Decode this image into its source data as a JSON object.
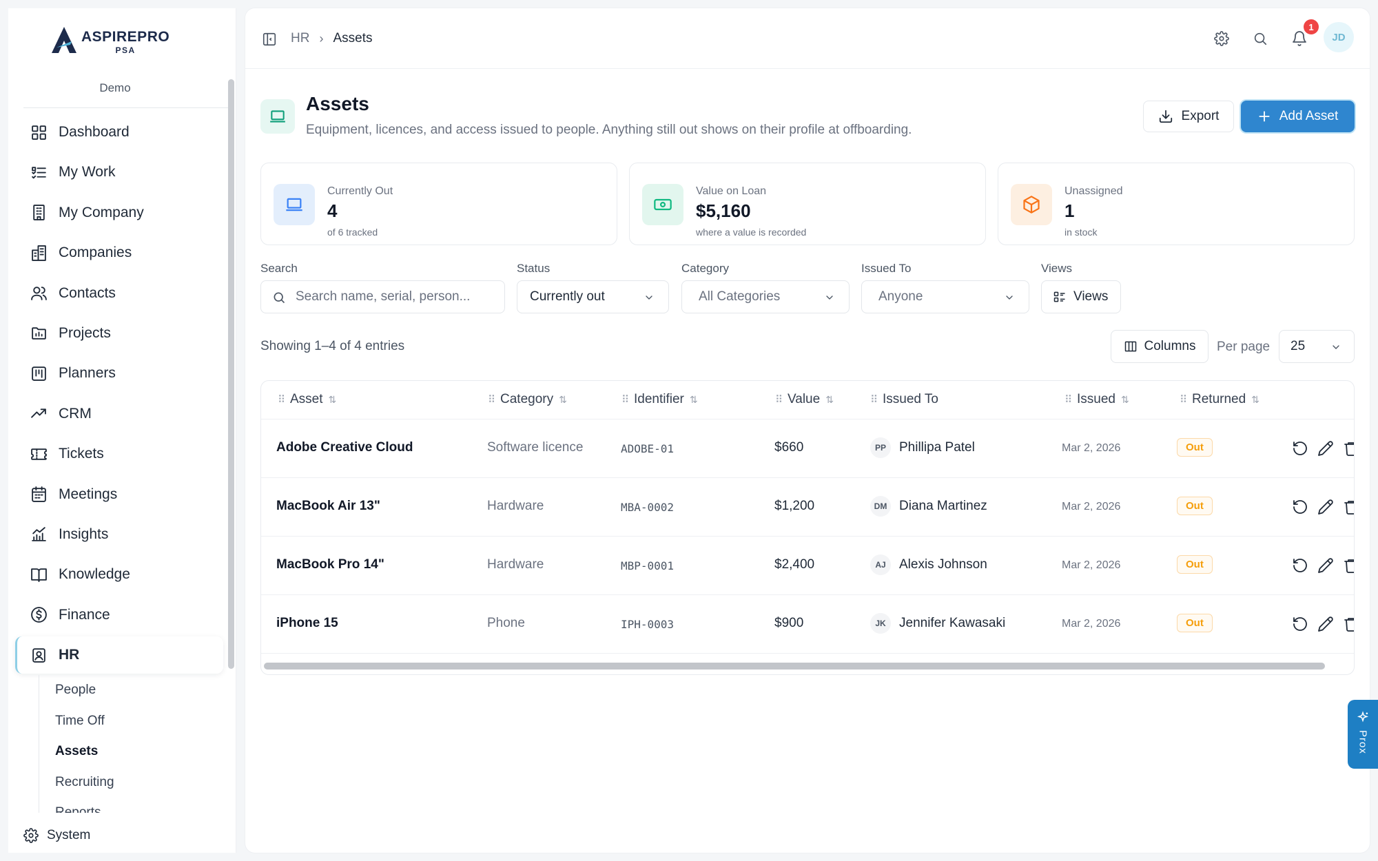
{
  "brand": {
    "name": "ASPIREPRO",
    "sub": "PSA",
    "workspace": "Demo"
  },
  "sidebar": {
    "items": [
      {
        "label": "Dashboard",
        "icon": "dashboard-icon"
      },
      {
        "label": "My Work",
        "icon": "checklist-icon"
      },
      {
        "label": "My Company",
        "icon": "building-icon"
      },
      {
        "label": "Companies",
        "icon": "office-buildings-icon"
      },
      {
        "label": "Contacts",
        "icon": "users-icon"
      },
      {
        "label": "Projects",
        "icon": "folder-chart-icon"
      },
      {
        "label": "Planners",
        "icon": "board-icon"
      },
      {
        "label": "CRM",
        "icon": "trend-icon"
      },
      {
        "label": "Tickets",
        "icon": "ticket-icon"
      },
      {
        "label": "Meetings",
        "icon": "calendar-icon"
      },
      {
        "label": "Insights",
        "icon": "bar-chart-icon"
      },
      {
        "label": "Knowledge",
        "icon": "book-icon"
      },
      {
        "label": "Finance",
        "icon": "dollar-circle-icon"
      },
      {
        "label": "HR",
        "icon": "id-badge-icon"
      }
    ],
    "hr_sub": [
      "People",
      "Time Off",
      "Assets",
      "Recruiting",
      "Reports"
    ],
    "system": "System"
  },
  "topbar": {
    "breadcrumb": [
      "HR",
      "Assets"
    ],
    "notification_count": "1",
    "avatar_initials": "JD"
  },
  "header": {
    "title": "Assets",
    "subtitle": "Equipment, licences, and access issued to people. Anything still out shows on their profile at offboarding.",
    "export_label": "Export",
    "add_label": "Add Asset"
  },
  "stats": [
    {
      "label": "Currently Out",
      "value": "4",
      "note": "of 6 tracked",
      "color": "#3b82f6"
    },
    {
      "label": "Value on Loan",
      "value": "$5,160",
      "note": "where a value is recorded",
      "color": "#10b981"
    },
    {
      "label": "Unassigned",
      "value": "1",
      "note": "in stock",
      "color": "#f97316"
    }
  ],
  "filters": {
    "search_label": "Search",
    "search_placeholder": "Search name, serial, person...",
    "status_label": "Status",
    "status_value": "Currently out",
    "category_label": "Category",
    "category_value": "All Categories",
    "issued_label": "Issued To",
    "issued_value": "Anyone",
    "views_label": "Views",
    "views_button": "Views"
  },
  "toolbar": {
    "showing": "Showing 1–4 of 4 entries",
    "columns_label": "Columns",
    "per_page_label": "Per page",
    "per_page_value": "25"
  },
  "table": {
    "headers": [
      "Asset",
      "Category",
      "Identifier",
      "Value",
      "Issued To",
      "Issued",
      "Returned"
    ],
    "rows": [
      {
        "asset": "Adobe Creative Cloud",
        "category": "Software licence",
        "identifier": "ADOBE-01",
        "value": "$660",
        "initials": "PP",
        "issued_to": "Phillipa Patel",
        "issued": "Mar 2, 2026",
        "status": "Out"
      },
      {
        "asset": "MacBook Air 13\"",
        "category": "Hardware",
        "identifier": "MBA-0002",
        "value": "$1,200",
        "initials": "DM",
        "issued_to": "Diana Martinez",
        "issued": "Mar 2, 2026",
        "status": "Out"
      },
      {
        "asset": "MacBook Pro 14\"",
        "category": "Hardware",
        "identifier": "MBP-0001",
        "value": "$2,400",
        "initials": "AJ",
        "issued_to": "Alexis Johnson",
        "issued": "Mar 2, 2026",
        "status": "Out"
      },
      {
        "asset": "iPhone 15",
        "category": "Phone",
        "identifier": "IPH-0003",
        "value": "$900",
        "initials": "JK",
        "issued_to": "Jennifer Kawasaki",
        "issued": "Mar 2, 2026",
        "status": "Out"
      }
    ]
  },
  "assistant": {
    "label": "Prox"
  }
}
